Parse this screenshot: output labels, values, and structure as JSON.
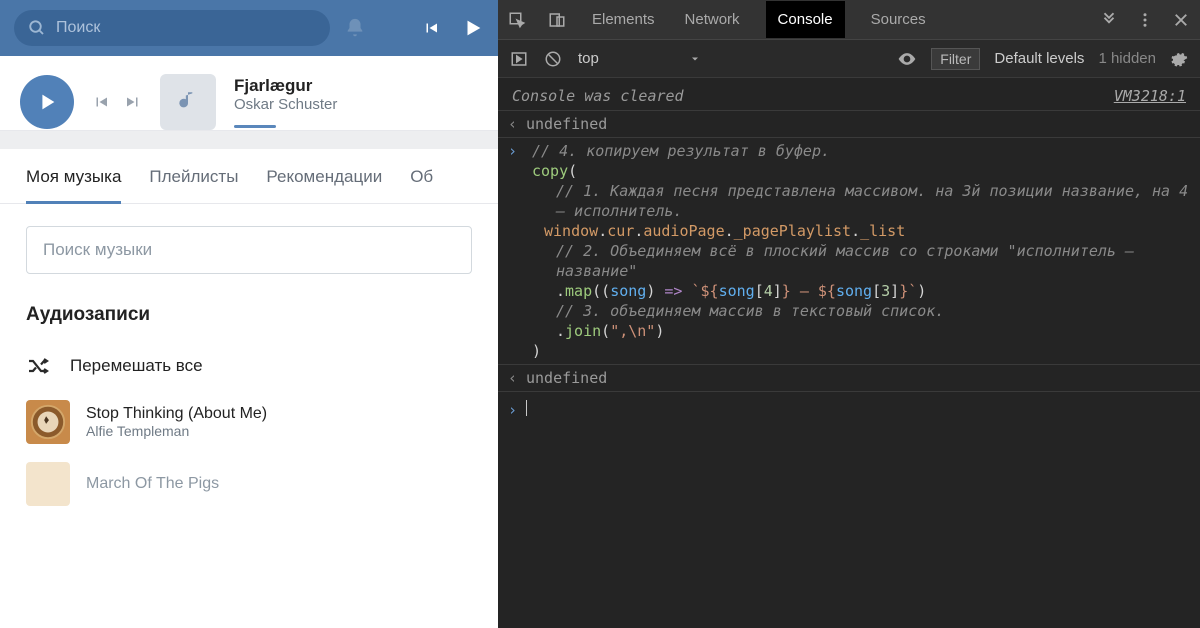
{
  "left": {
    "search_placeholder": "Поиск",
    "player": {
      "title": "Fjarlægur",
      "artist": "Oskar Schuster"
    },
    "tabs": [
      "Моя музыка",
      "Плейлисты",
      "Рекомендации",
      "Об"
    ],
    "music_search_placeholder": "Поиск музыки",
    "section_title": "Аудиозаписи",
    "shuffle_label": "Перемешать все",
    "tracks": [
      {
        "title": "Stop Thinking (About Me)",
        "artist": "Alfie Templeman"
      },
      {
        "title": "March Of The Pigs",
        "artist": ""
      }
    ]
  },
  "devtools": {
    "tabs": [
      "Elements",
      "Network",
      "Console",
      "Sources"
    ],
    "context": "top",
    "filter_placeholder": "Filter",
    "levels_label": "Default levels",
    "hidden_label": "1 hidden",
    "cleared_msg": "Console was cleared",
    "cleared_src": "VM3218:1",
    "undefined_label": "undefined",
    "code": {
      "c4": "// 4. копируем результат в буфер.",
      "copy": "copy",
      "open": "(",
      "c1": "// 1. Каждая песня представлена массивом. на 3й позиции название, на 4 — исполнитель.",
      "path_window": "window",
      "path_cur": "cur",
      "path_audioPage": "audioPage",
      "path_pagePlaylist": "_pagePlaylist",
      "path_list": "_list",
      "c2": "// 2. Объединяем всё в плоский массив со строками \"исполнитель — название\"",
      "map": "map",
      "song": "song",
      "arrow": "=>",
      "tpl_open": "`${",
      "idx4": "4",
      "tpl_mid": "} — ${",
      "idx3": "3",
      "tpl_close": "}`",
      "c3": "// 3. объединяем массив в текстовый список.",
      "join": "join",
      "join_arg": "\",\\n\"",
      "close": ")"
    }
  }
}
